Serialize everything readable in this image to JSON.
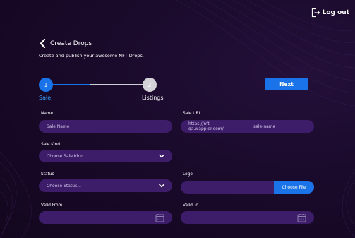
{
  "header": {
    "logout_label": "Log out",
    "logout_icon": "logout-icon"
  },
  "page": {
    "back_icon": "chevron-left-icon",
    "title": "Create Drops",
    "subtitle": "Create and publish your awesome NFT Drops."
  },
  "stepper": {
    "steps": [
      {
        "number": "1",
        "label": "Sale",
        "state": "active"
      },
      {
        "number": "2",
        "label": "Listings",
        "state": "inactive"
      }
    ],
    "progress": 0.4
  },
  "actions": {
    "next_label": "Next"
  },
  "form": {
    "name": {
      "label": "Name",
      "placeholder": "Sale Name",
      "value": ""
    },
    "sale_url": {
      "label": "Sale URL",
      "prefix": "https://nft-qa.wappier.com/",
      "placeholder": "sale-name",
      "value": ""
    },
    "sale_kind": {
      "label": "Sale Kind",
      "selected": "Choose Sale Kind..."
    },
    "status": {
      "label": "Status",
      "selected": "Choose Status..."
    },
    "logo": {
      "label": "Logo",
      "button_label": "Choose File"
    },
    "valid_from": {
      "label": "Valid From",
      "value": ""
    },
    "valid_to": {
      "label": "Valid To",
      "value": ""
    }
  },
  "colors": {
    "background": "#1a0a2a",
    "accent": "#1a73e8",
    "field": "#3d1d6a",
    "step_active_label": "#3aa0ff",
    "step_inactive": "#d2d2d8"
  }
}
